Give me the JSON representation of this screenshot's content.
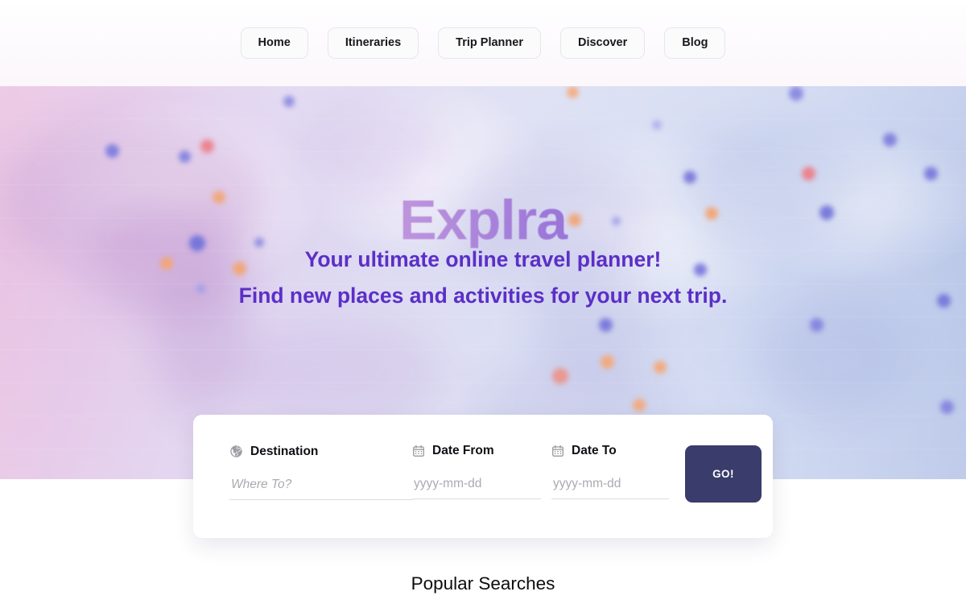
{
  "nav": {
    "items": [
      {
        "label": "Home"
      },
      {
        "label": "Itineraries"
      },
      {
        "label": "Trip Planner"
      },
      {
        "label": "Discover"
      },
      {
        "label": "Blog"
      }
    ]
  },
  "hero": {
    "logo": "Explra",
    "tagline_line1": "Your ultimate online travel planner!",
    "tagline_line2": "Find new places and activities for your next trip.",
    "colors": {
      "logo_gradient_start": "#f9cddd",
      "logo_gradient_end": "#5330c6",
      "tagline_color": "#5b2fc7",
      "bg_left": "#e9bfdf",
      "bg_right": "#b3c2e6"
    }
  },
  "search": {
    "destination": {
      "label": "Destination",
      "placeholder": "Where To?",
      "value": "",
      "icon": "globe-icon"
    },
    "date_from": {
      "label": "Date From",
      "placeholder": "yyyy-mm-dd",
      "value": "",
      "icon": "calendar-icon"
    },
    "date_to": {
      "label": "Date To",
      "placeholder": "yyyy-mm-dd",
      "value": "",
      "icon": "calendar-icon"
    },
    "submit_label": "GO!",
    "submit_color": "#3a3c6b"
  },
  "sections": {
    "popular_searches_title": "Popular Searches"
  }
}
